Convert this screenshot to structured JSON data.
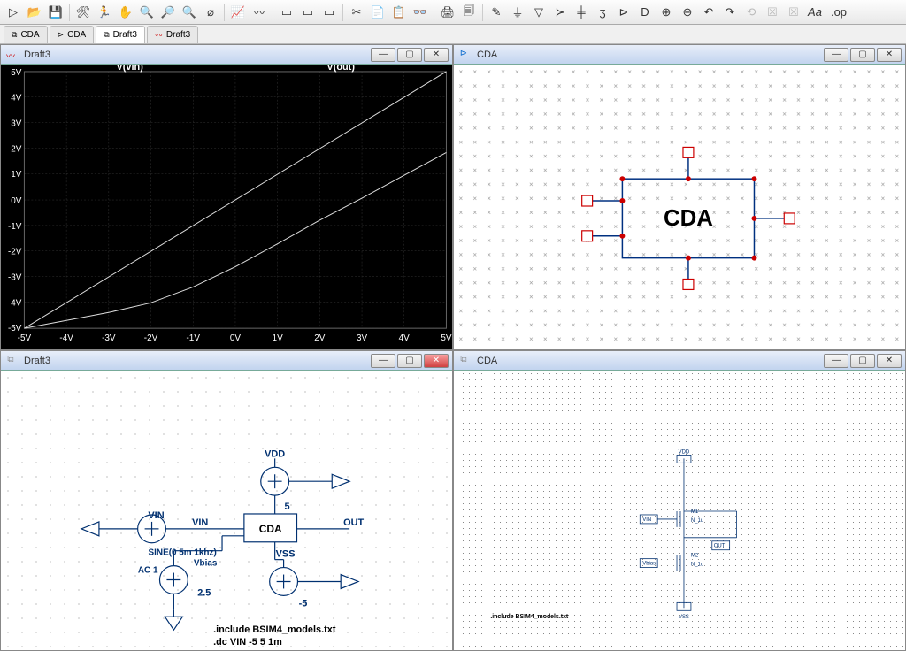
{
  "toolbar": {
    "icons": [
      "▷",
      "📂",
      "💾",
      "🛠",
      "🏃",
      "✋",
      "🔍+",
      "🔍",
      "🔍-",
      "⌀",
      "📋",
      "〰",
      "⇄",
      "▭",
      "▭▭",
      "▭▭▭",
      "✂",
      "📄",
      "📋",
      "👓",
      "🖨",
      "🗐",
      "✎",
      "⏚",
      "▽",
      "≻",
      "╪",
      "ʒ",
      "⊳",
      "D",
      "⊕",
      "⊖",
      "↶",
      "↷",
      "⟲",
      "☒",
      "☒",
      "Aa",
      ".op"
    ]
  },
  "tabs": [
    {
      "icon": "⧉",
      "label": "CDA"
    },
    {
      "icon": "⊳",
      "label": "CDA"
    },
    {
      "icon": "⧉",
      "label": "Draft3"
    },
    {
      "icon": "〰",
      "label": "Draft3"
    }
  ],
  "panes": {
    "top_left": {
      "title": "Draft3"
    },
    "top_right": {
      "title": "CDA"
    },
    "bottom_left": {
      "title": "Draft3"
    },
    "bottom_right": {
      "title": "CDA"
    }
  },
  "chart_data": {
    "type": "line",
    "title": "",
    "xlabel": "",
    "ylabel": "",
    "xlim": [
      -5,
      5
    ],
    "ylim": [
      -5,
      5
    ],
    "x_ticks": [
      "-5V",
      "-4V",
      "-3V",
      "-2V",
      "-1V",
      "0V",
      "1V",
      "2V",
      "3V",
      "4V",
      "5V"
    ],
    "y_ticks": [
      "-5V",
      "-4V",
      "-3V",
      "-2V",
      "-1V",
      "0V",
      "1V",
      "2V",
      "3V",
      "4V",
      "5V"
    ],
    "series": [
      {
        "name": "V(vin)",
        "x": [
          -5,
          5
        ],
        "y": [
          -5,
          5
        ]
      },
      {
        "name": "V(out)",
        "x": [
          -5,
          -4,
          -3,
          -2,
          -1,
          0,
          1,
          2,
          3,
          4,
          5
        ],
        "y": [
          -5,
          -4.7,
          -4.4,
          -4.0,
          -3.4,
          -2.6,
          -1.7,
          -0.8,
          0.05,
          0.95,
          1.85
        ]
      }
    ]
  },
  "top_right_symbol": {
    "label": "CDA"
  },
  "bottom_left_schem": {
    "labels": {
      "vdd": "VDD",
      "vdd_val": "5",
      "vin": "VIN",
      "vin_net": "VIN",
      "block": "CDA",
      "out": "OUT",
      "vss": "VSS",
      "vss_val": "-5",
      "sine": "SINE(0 5m 1khz)",
      "vbias_name": "Vbias",
      "ac": "AC 1",
      "vbias_val": "2.5",
      "inc": ".include BSIM4_models.txt",
      "dc": ".dc VIN -5 5 1m"
    }
  },
  "bottom_right_schem": {
    "labels": {
      "vdd": "VDD",
      "m1": "M1",
      "m1p": "N_1u",
      "m2": "M2",
      "m2p": "N_1u",
      "vin": "VIN",
      "out": "OUT",
      "vbias": "Vbias",
      "vss": "VSS",
      "inc": ".include BSIM4_models.txt"
    }
  }
}
